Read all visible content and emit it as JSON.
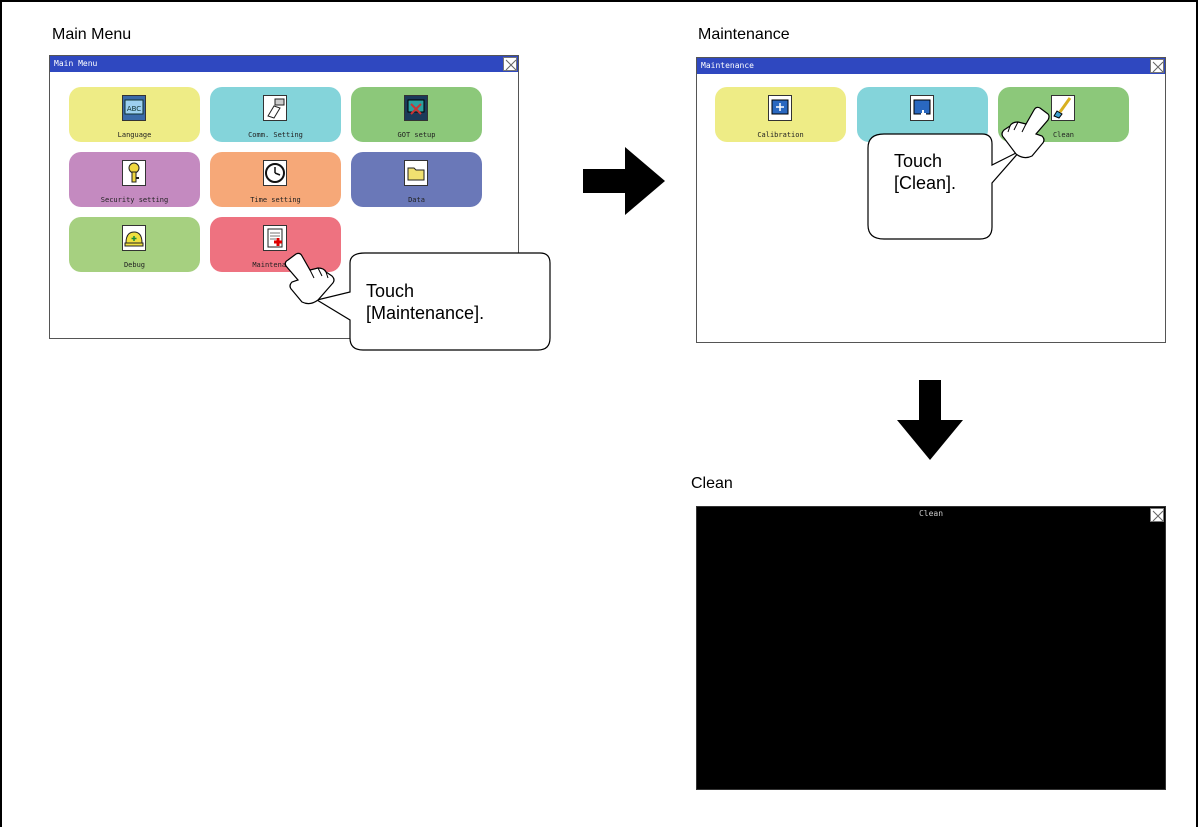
{
  "captions": {
    "main_menu": "Main Menu",
    "maintenance": "Maintenance",
    "clean": "Clean"
  },
  "main_menu_screen": {
    "title": "Main Menu",
    "tiles": [
      {
        "label": "Language",
        "color": "#eeec86",
        "icon": "abc-icon"
      },
      {
        "label": "Comm. Setting",
        "color": "#84d4da",
        "icon": "connector-icon"
      },
      {
        "label": "GOT setup",
        "color": "#8cc87a",
        "icon": "monitor-tools-icon"
      },
      {
        "label": "Security setting",
        "color": "#c48ac0",
        "icon": "key-icon"
      },
      {
        "label": "Time setting",
        "color": "#f6a878",
        "icon": "clock-icon"
      },
      {
        "label": "Data",
        "color": "#6a78b8",
        "icon": "folder-icon"
      },
      {
        "label": "Debug",
        "color": "#a6d080",
        "icon": "helmet-icon"
      },
      {
        "label": "Maintenance",
        "color": "#ee7280",
        "icon": "medical-document-icon"
      }
    ],
    "callout": {
      "line1": "Touch",
      "line2": "[Maintenance]."
    }
  },
  "maintenance_screen": {
    "title": "Maintenance",
    "tiles": [
      {
        "label": "Calibration",
        "color": "#eeec86",
        "icon": "calibration-icon"
      },
      {
        "label": "",
        "color": "#84d4da",
        "icon": "touch-panel-icon"
      },
      {
        "label": "Clean",
        "color": "#8cc87a",
        "icon": "brush-icon"
      }
    ],
    "callout": {
      "line1": "Touch",
      "line2": "[Clean]."
    }
  },
  "clean_screen": {
    "title": "Clean"
  }
}
